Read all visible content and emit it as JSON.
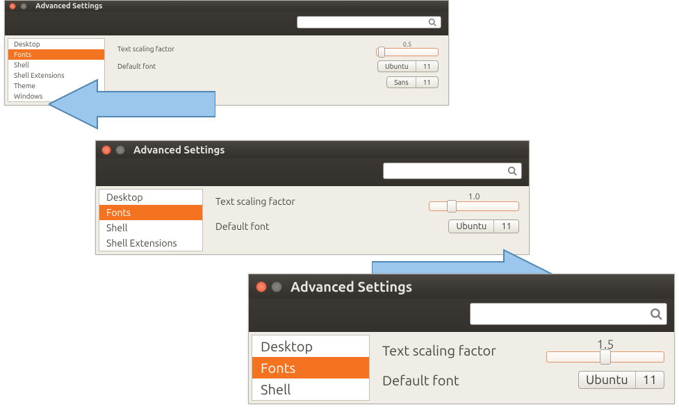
{
  "windows": [
    {
      "id": "small",
      "title": "Advanced Settings",
      "search_placeholder": "",
      "sidebar": {
        "items": [
          "Desktop",
          "Fonts",
          "Shell",
          "Shell Extensions",
          "Theme",
          "Windows"
        ],
        "selected_index": 1
      },
      "rows": {
        "scaling_label": "Text scaling factor",
        "scaling_value": "0.5",
        "default_font_label": "Default font",
        "default_font_name": "Ubuntu",
        "default_font_size": "11",
        "extra_font_name": "Sans",
        "extra_font_size": "11"
      }
    },
    {
      "id": "med",
      "title": "Advanced Settings",
      "search_placeholder": "",
      "sidebar": {
        "items": [
          "Desktop",
          "Fonts",
          "Shell",
          "Shell Extensions"
        ],
        "selected_index": 1
      },
      "rows": {
        "scaling_label": "Text scaling factor",
        "scaling_value": "1.0",
        "default_font_label": "Default font",
        "default_font_name": "Ubuntu",
        "default_font_size": "11"
      }
    },
    {
      "id": "big",
      "title": "Advanced Settings",
      "search_placeholder": "",
      "sidebar": {
        "items": [
          "Desktop",
          "Fonts",
          "Shell"
        ],
        "selected_index": 1
      },
      "rows": {
        "scaling_label": "Text scaling factor",
        "scaling_value": "1.5",
        "default_font_label": "Default font",
        "default_font_name": "Ubuntu",
        "default_font_size": "11"
      }
    }
  ]
}
